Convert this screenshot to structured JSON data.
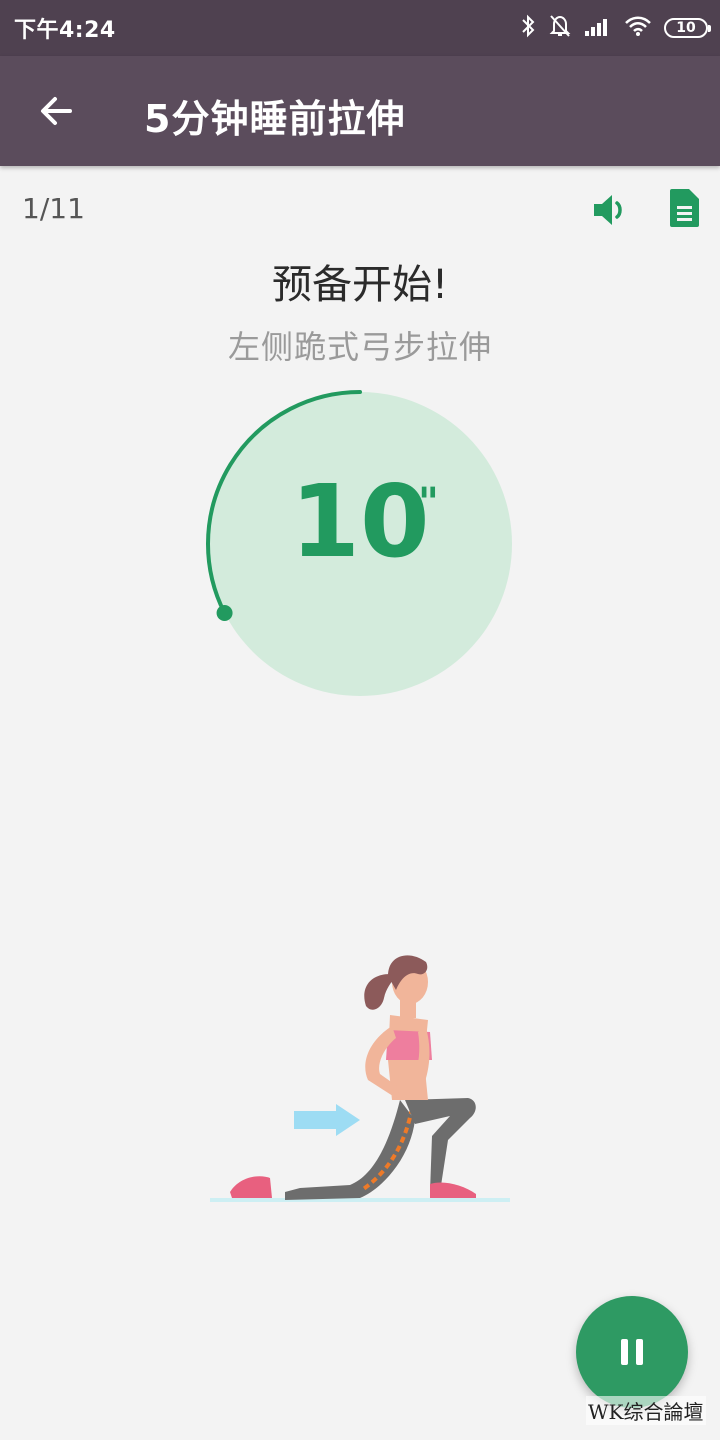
{
  "status_bar": {
    "time": "下午4:24",
    "battery": "10",
    "icons": [
      "bluetooth-icon",
      "mute-bell-icon",
      "signal-icon",
      "wifi-icon",
      "battery-icon"
    ]
  },
  "app_bar": {
    "title": "5分钟睡前拉伸",
    "back_icon": "arrow-left-icon"
  },
  "workout": {
    "progress": "1/11",
    "ready_title": "预备开始!",
    "exercise_name": "左侧跪式弓步拉伸",
    "countdown_value": "10",
    "countdown_unit": "\"",
    "countdown_progress_fraction": 0.25
  },
  "actions": {
    "sound_icon": "volume-icon",
    "doc_icon": "document-icon",
    "pause_icon": "pause-icon"
  },
  "watermark": "WK综合論壇",
  "colors": {
    "status_bar": "#4f4150",
    "app_bar": "#5b4c5c",
    "accent": "#229a5f",
    "ring_fill": "#d3ebdc",
    "fab": "#2e9a63"
  }
}
